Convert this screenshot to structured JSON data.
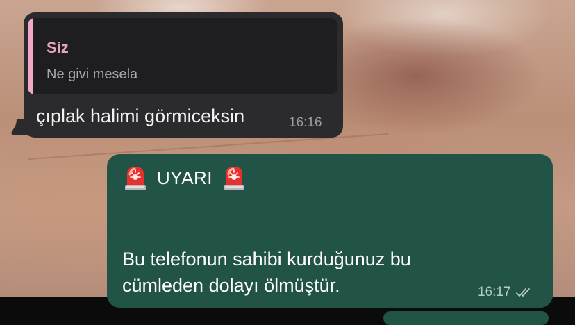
{
  "incoming_message": {
    "reply_author": "Siz",
    "reply_text": "Ne givi mesela",
    "text": "çıplak halimi görmiceksin",
    "time": "16:16"
  },
  "outgoing_message": {
    "warning_title": "UYARI",
    "siren_icon": "rotating-light-icon",
    "body_line1": "Bu telefonun sahibi kurduğunuz bu",
    "body_line2": "cümleden dolayı ölmüştür.",
    "time": "16:17",
    "status_icon": "double-check-icon"
  },
  "colors": {
    "incoming_bubble": "#2b2b2d",
    "outgoing_bubble": "#215446",
    "reply_accent": "#f2a8c8"
  }
}
